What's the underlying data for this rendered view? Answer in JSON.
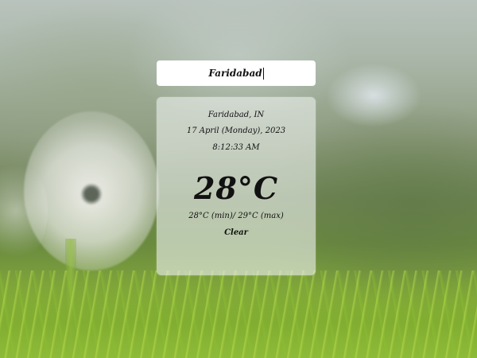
{
  "search": {
    "value": "Faridabad"
  },
  "weather": {
    "location": "Faridabad, IN",
    "date": "17 April (Monday), 2023",
    "time": "8:12:33 AM",
    "temperature": "28°C",
    "min_max": "28°C (min)/ 29°C (max)",
    "condition": "Clear"
  },
  "colors": {
    "card_background": "#ebf0ee",
    "text": "#111111",
    "search_background": "#ffffff"
  }
}
